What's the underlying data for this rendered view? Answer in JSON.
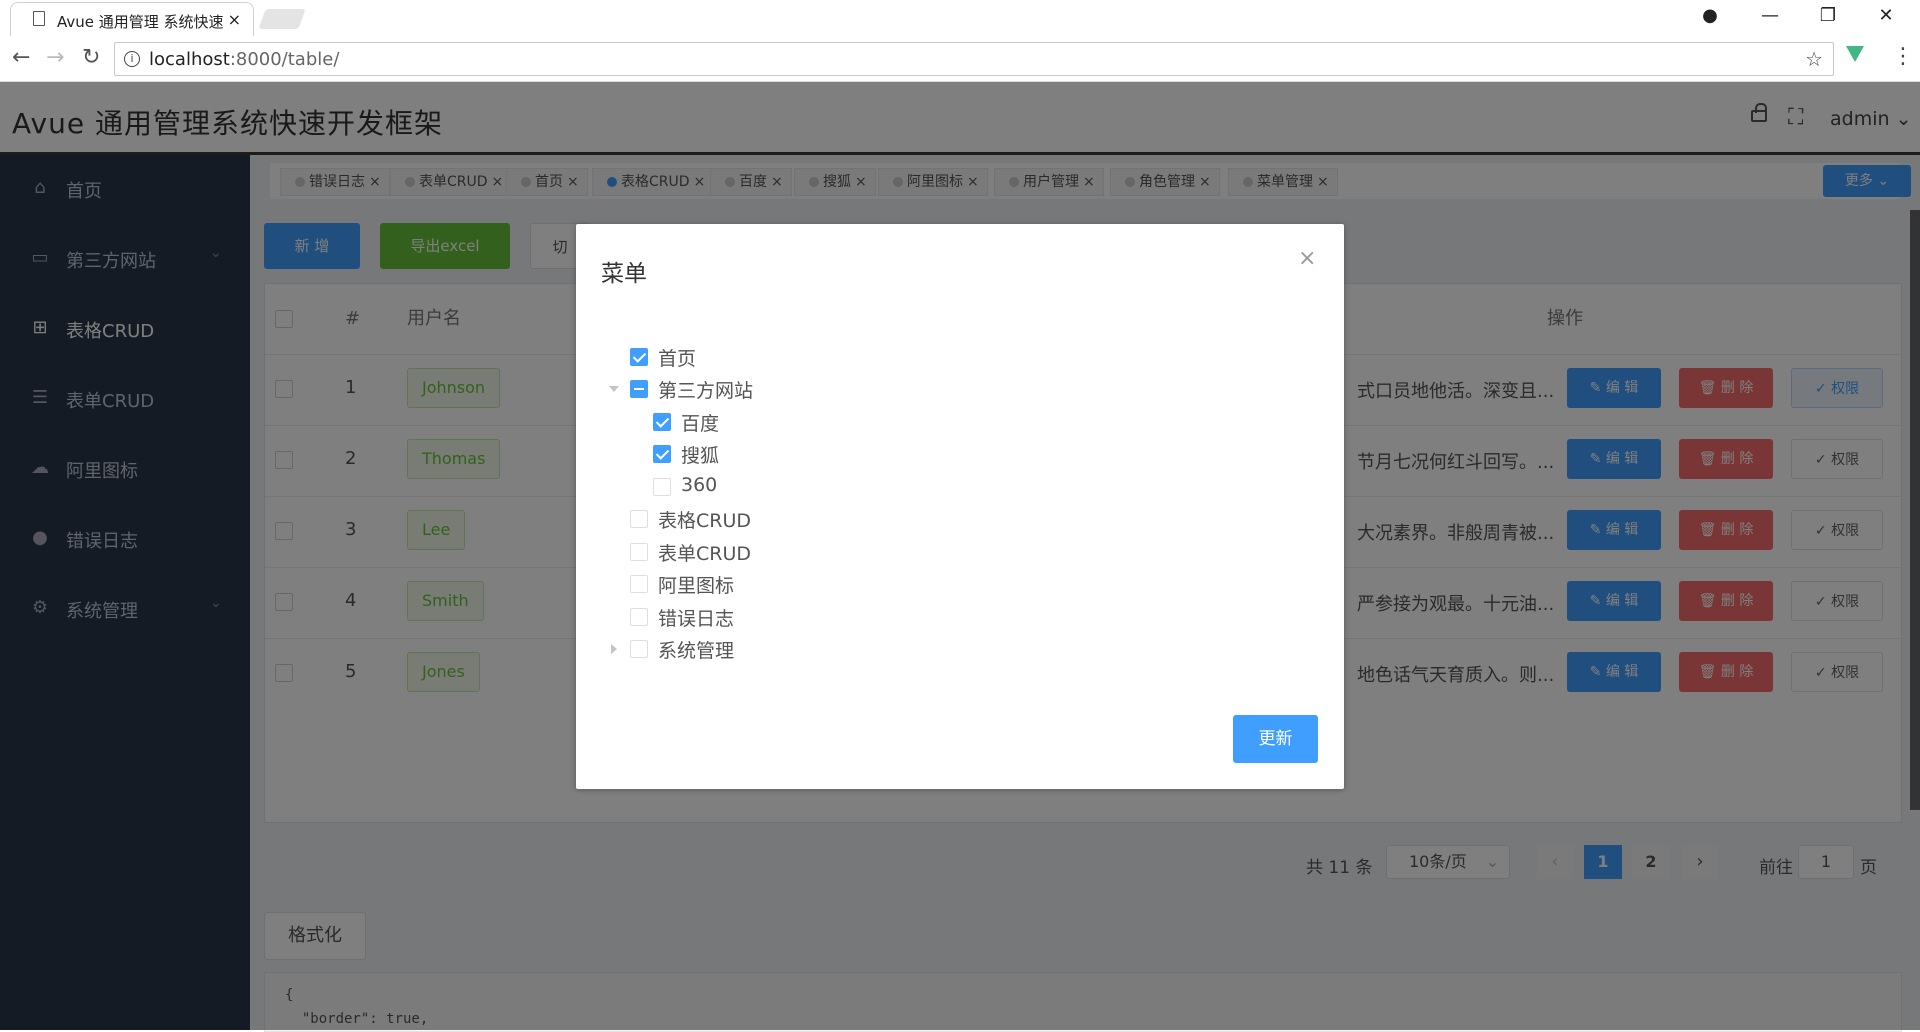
{
  "browser": {
    "tab_title": "Avue 通用管理 系统快速",
    "url_host": "localhost",
    "url_path": ":8000/table/"
  },
  "header": {
    "brand": "Avue 通用管理系统快速开发框架",
    "user": "admin"
  },
  "sidebar": {
    "items": [
      {
        "label": "首页",
        "icon": "home-icon"
      },
      {
        "label": "第三方网站",
        "icon": "window-icon",
        "has_arrow": true
      },
      {
        "label": "表格CRUD",
        "icon": "table-icon",
        "active": true
      },
      {
        "label": "表单CRUD",
        "icon": "form-icon"
      },
      {
        "label": "阿里图标",
        "icon": "cloud-icon"
      },
      {
        "label": "错误日志",
        "icon": "error-icon"
      },
      {
        "label": "系统管理",
        "icon": "gear-icon",
        "has_arrow": true
      }
    ]
  },
  "tags": [
    {
      "label": "错误日志"
    },
    {
      "label": "表单CRUD"
    },
    {
      "label": "首页"
    },
    {
      "label": "表格CRUD",
      "active": true
    },
    {
      "label": "百度"
    },
    {
      "label": "搜狐"
    },
    {
      "label": "阿里图标"
    },
    {
      "label": "用户管理"
    },
    {
      "label": "角色管理"
    },
    {
      "label": "菜单管理"
    }
  ],
  "more_label": "更多",
  "toolbar": {
    "add_label": "新 增",
    "export_label": "导出excel",
    "toggle_label": "切"
  },
  "table": {
    "headers": {
      "index": "#",
      "username": "用户名",
      "actions": "操作"
    },
    "rows": [
      {
        "index": "1",
        "username": "Johnson",
        "desc": "式口员地他活。深变且..."
      },
      {
        "index": "2",
        "username": "Thomas",
        "desc": "节月七况何红斗回写。..."
      },
      {
        "index": "3",
        "username": "Lee",
        "desc": "大况素界。非般周青被..."
      },
      {
        "index": "4",
        "username": "Smith",
        "desc": "严参接为观最。十元油..."
      },
      {
        "index": "5",
        "username": "Jones",
        "desc": "地色话气天育质入。则..."
      }
    ],
    "edit_label": "编 辑",
    "delete_label": "删 除",
    "perm_label": "权限"
  },
  "pagination": {
    "total": "共 11 条",
    "page_size": "10条/页",
    "pages": [
      "1",
      "2"
    ],
    "current": "1",
    "goto_prefix": "前往",
    "goto_value": "1",
    "goto_suffix": "页"
  },
  "format_label": "格式化",
  "code_text": "{\n  \"border\": true,",
  "dialog": {
    "title": "菜单",
    "tree": [
      {
        "label": "首页",
        "state": "checked"
      },
      {
        "label": "第三方网站",
        "state": "half",
        "expanded": true,
        "children": [
          {
            "label": "百度",
            "state": "checked"
          },
          {
            "label": "搜狐",
            "state": "checked"
          },
          {
            "label": "360",
            "state": "unchecked"
          }
        ]
      },
      {
        "label": "表格CRUD",
        "state": "unchecked"
      },
      {
        "label": "表单CRUD",
        "state": "unchecked"
      },
      {
        "label": "阿里图标",
        "state": "unchecked"
      },
      {
        "label": "错误日志",
        "state": "unchecked"
      },
      {
        "label": "系统管理",
        "state": "unchecked",
        "collapsed": true
      }
    ],
    "update_label": "更新"
  },
  "colors": {
    "primary": "#409eff",
    "success": "#67c23a",
    "danger": "#f56c6c",
    "sidebar": "#2b3648"
  }
}
